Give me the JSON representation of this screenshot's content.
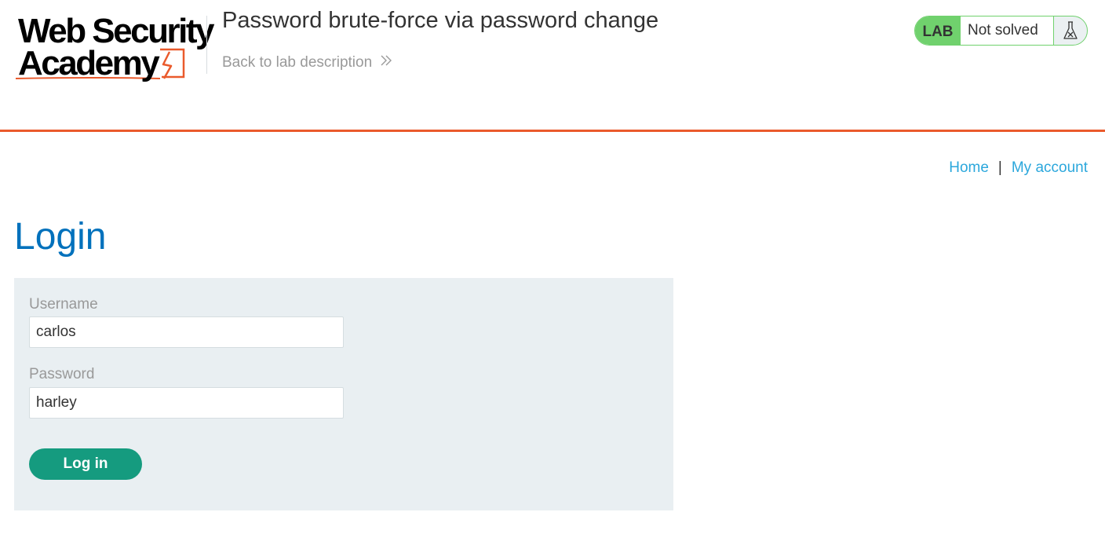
{
  "brand": {
    "logo_line1": "Web Security",
    "logo_line2": "Academy",
    "accent_color": "#ea5a2c"
  },
  "header": {
    "lab_title": "Password brute-force via password change",
    "back_link": "Back to lab description",
    "back_icon": "double-chevron-right-icon"
  },
  "status": {
    "badge": "LAB",
    "text": "Not solved",
    "icon": "flask-icon",
    "color": "#70d16d"
  },
  "nav": {
    "home": "Home",
    "separator": "|",
    "account": "My account",
    "link_color": "#2ba7dc"
  },
  "page": {
    "heading": "Login",
    "heading_color": "#0071bc"
  },
  "form": {
    "username_label": "Username",
    "username_value": "carlos",
    "password_label": "Password",
    "password_value": "harley",
    "submit_label": "Log in",
    "button_color": "#159b7f"
  }
}
